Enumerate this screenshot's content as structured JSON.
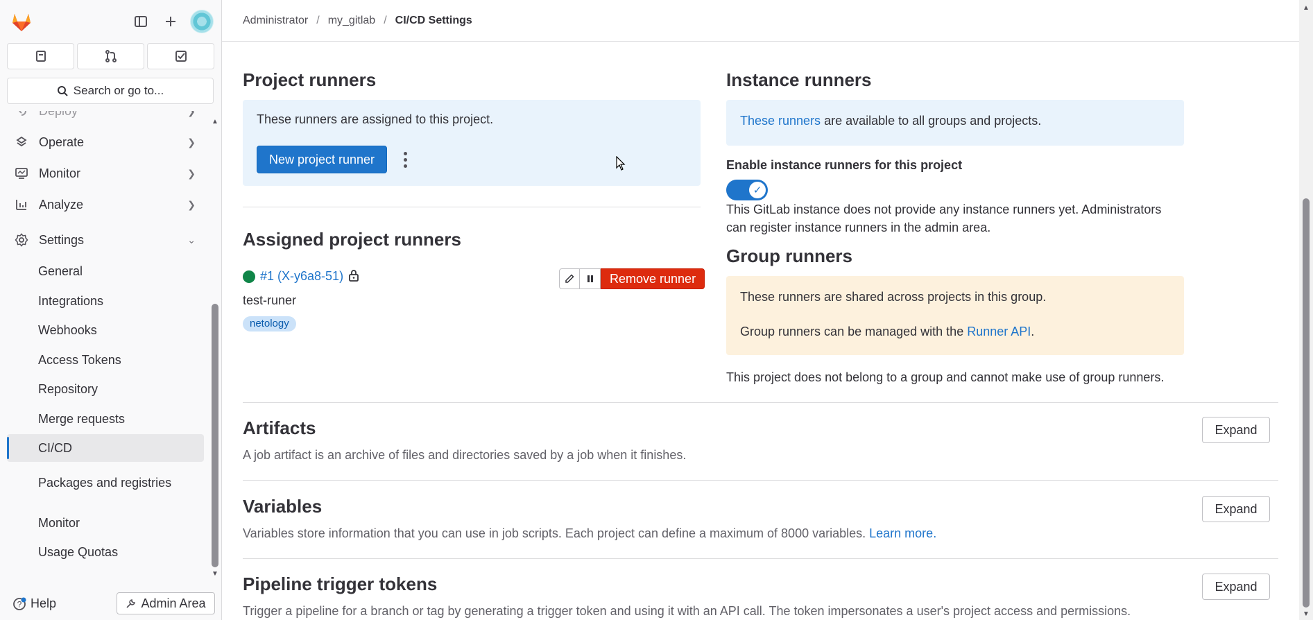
{
  "sidebar": {
    "search_label": "Search or go to...",
    "nav": [
      {
        "label": "Deploy",
        "icon": "deploy-icon"
      },
      {
        "label": "Operate",
        "icon": "operate-icon"
      },
      {
        "label": "Monitor",
        "icon": "monitor-icon"
      },
      {
        "label": "Analyze",
        "icon": "analyze-icon"
      },
      {
        "label": "Settings",
        "icon": "settings-icon"
      }
    ],
    "settings_items": [
      {
        "label": "General"
      },
      {
        "label": "Integrations"
      },
      {
        "label": "Webhooks"
      },
      {
        "label": "Access Tokens"
      },
      {
        "label": "Repository"
      },
      {
        "label": "Merge requests"
      },
      {
        "label": "CI/CD",
        "active": true
      },
      {
        "label": "Packages and registries"
      },
      {
        "label": "Monitor"
      },
      {
        "label": "Usage Quotas"
      }
    ],
    "help_label": "Help",
    "admin_label": "Admin Area"
  },
  "breadcrumb": {
    "items": [
      "Administrator",
      "my_gitlab",
      "CI/CD Settings"
    ]
  },
  "project_runners": {
    "title": "Project runners",
    "info": "These runners are assigned to this project.",
    "new_button": "New project runner"
  },
  "assigned": {
    "title": "Assigned project runners",
    "runner": {
      "link": "#1 (X-y6a8-51)",
      "description": "test-runer",
      "tag": "netology",
      "remove_label": "Remove runner"
    }
  },
  "instance_runners": {
    "title": "Instance runners",
    "link": "These runners",
    "info_rest": " are available to all groups and projects.",
    "toggle_label": "Enable instance runners for this project",
    "toggle_on": true,
    "note_line1": "This GitLab instance does not provide any instance runners yet. Administrators",
    "note_line2": "can register instance runners in the admin area."
  },
  "group_runners": {
    "title": "Group runners",
    "info1": "These runners are shared across projects in this group.",
    "info2_prefix": "Group runners can be managed with the ",
    "info2_link": "Runner API",
    "info2_suffix": ".",
    "note": "This project does not belong to a group and cannot make use of group runners."
  },
  "sections": [
    {
      "title": "Artifacts",
      "desc": "A job artifact is an archive of files and directories saved by a job when it finishes.",
      "link": "",
      "button": "Expand"
    },
    {
      "title": "Variables",
      "desc": "Variables store information that you can use in job scripts. Each project can define a maximum of 8000 variables. ",
      "link": "Learn more.",
      "button": "Expand"
    },
    {
      "title": "Pipeline trigger tokens",
      "desc": "Trigger a pipeline for a branch or tag by generating a trigger token and using it with an API call. The token impersonates a user's project access and permissions.",
      "link": "",
      "button": "Expand"
    }
  ],
  "colors": {
    "primary": "#1f75cb",
    "danger": "#dd2b0e",
    "success": "#108548",
    "info_bg": "#e9f3fc",
    "warning_bg": "#fdf1dd"
  }
}
